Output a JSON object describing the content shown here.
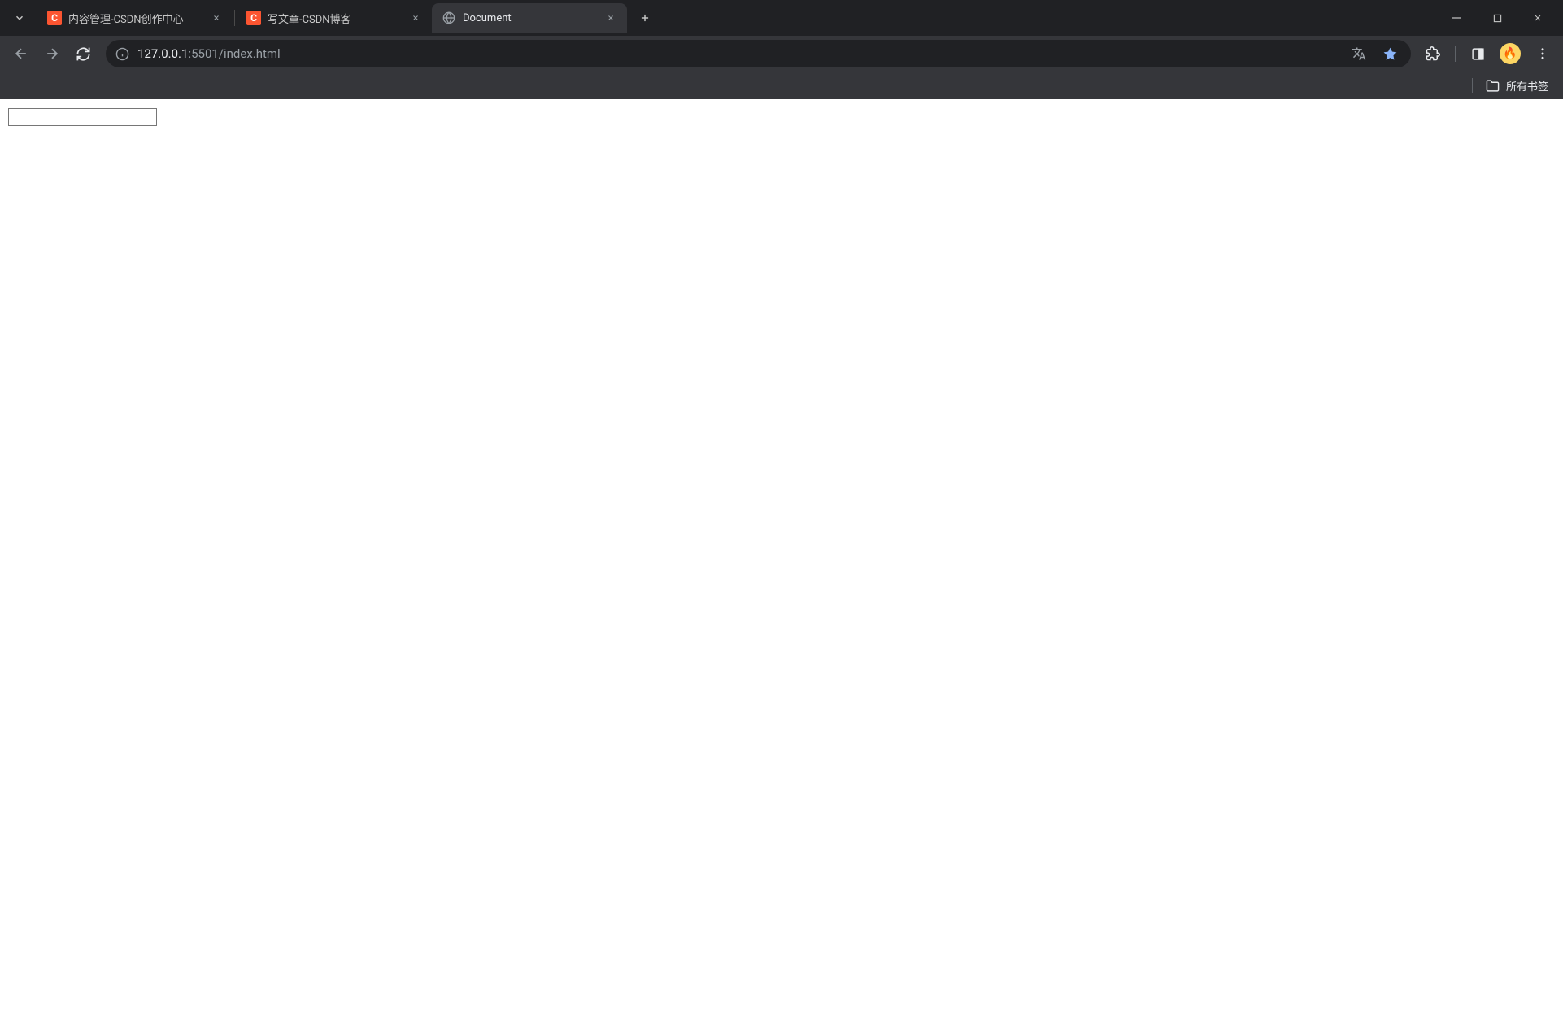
{
  "tabs": [
    {
      "title": "内容管理-CSDN创作中心",
      "favicon": "csdn",
      "active": false
    },
    {
      "title": "写文章-CSDN博客",
      "favicon": "csdn",
      "active": false
    },
    {
      "title": "Document",
      "favicon": "globe",
      "active": true
    }
  ],
  "url": {
    "host": "127.0.0.1",
    "port_path": ":5501/index.html"
  },
  "bookmarks": {
    "all_label": "所有书签"
  },
  "page": {
    "input_value": ""
  }
}
